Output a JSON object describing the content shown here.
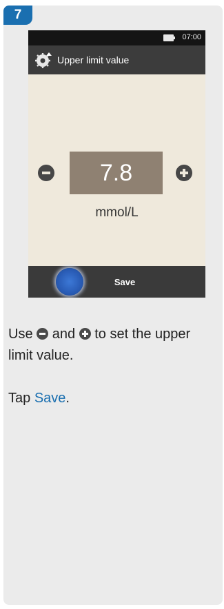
{
  "step": {
    "number": "7"
  },
  "phone": {
    "status_bar": {
      "time": "07:00",
      "battery_icon": "battery-icon"
    },
    "title_bar": {
      "title": "Upper limit value",
      "icon": "settings-icon"
    },
    "value": "7.8",
    "unit": "mmol/L",
    "bottom_bar": {
      "save_label": "Save"
    }
  },
  "instructions": {
    "line1_prefix": "Use",
    "line1_and": "and",
    "line1_suffix": "to set the upper limit value.",
    "line2_prefix": "Tap",
    "line2_link": "Save",
    "line2_suffix": "."
  },
  "colors": {
    "accent": "#1a6fb0",
    "screen_bg": "#efe9dc",
    "value_box": "#8f8172",
    "card_bg": "#ebebeb"
  }
}
